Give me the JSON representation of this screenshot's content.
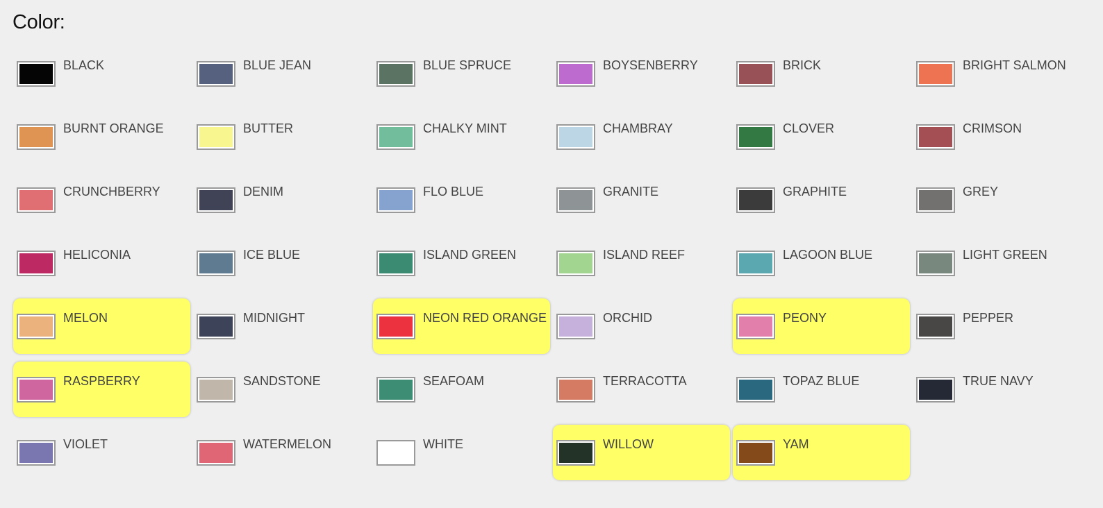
{
  "heading": "Color:",
  "colors": [
    {
      "name": "BLACK",
      "hex": "#050505",
      "selected": false
    },
    {
      "name": "BLUE JEAN",
      "hex": "#566180",
      "selected": false
    },
    {
      "name": "BLUE SPRUCE",
      "hex": "#5a7362",
      "selected": false
    },
    {
      "name": "BOYSENBERRY",
      "hex": "#bd6bce",
      "selected": false
    },
    {
      "name": "BRICK",
      "hex": "#985157",
      "selected": false
    },
    {
      "name": "BRIGHT SALMON",
      "hex": "#ee7352",
      "selected": false
    },
    {
      "name": "BURNT ORANGE",
      "hex": "#df9454",
      "selected": false
    },
    {
      "name": "BUTTER",
      "hex": "#f8f78f",
      "selected": false
    },
    {
      "name": "CHALKY MINT",
      "hex": "#72be9c",
      "selected": false
    },
    {
      "name": "CHAMBRAY",
      "hex": "#bcd6e6",
      "selected": false
    },
    {
      "name": "CLOVER",
      "hex": "#327944",
      "selected": false
    },
    {
      "name": "CRIMSON",
      "hex": "#a44f54",
      "selected": false
    },
    {
      "name": "CRUNCHBERRY",
      "hex": "#df6f73",
      "selected": false
    },
    {
      "name": "DENIM",
      "hex": "#404355",
      "selected": false
    },
    {
      "name": "FLO BLUE",
      "hex": "#86a3cf",
      "selected": false
    },
    {
      "name": "GRANITE",
      "hex": "#8e9496",
      "selected": false
    },
    {
      "name": "GRAPHITE",
      "hex": "#3b3b3b",
      "selected": false
    },
    {
      "name": "GREY",
      "hex": "#727170",
      "selected": false
    },
    {
      "name": "HELICONIA",
      "hex": "#bd2a63",
      "selected": false
    },
    {
      "name": "ICE BLUE",
      "hex": "#5f7b91",
      "selected": false
    },
    {
      "name": "ISLAND GREEN",
      "hex": "#3b8b73",
      "selected": false
    },
    {
      "name": "ISLAND REEF",
      "hex": "#a2d690",
      "selected": false
    },
    {
      "name": "LAGOON BLUE",
      "hex": "#5ba8b0",
      "selected": false
    },
    {
      "name": "LIGHT GREEN",
      "hex": "#78887f",
      "selected": false
    },
    {
      "name": "MELON",
      "hex": "#ecb27d",
      "selected": true
    },
    {
      "name": "MIDNIGHT",
      "hex": "#3d4459",
      "selected": false
    },
    {
      "name": "NEON RED ORANGE",
      "hex": "#ec323f",
      "selected": true
    },
    {
      "name": "ORCHID",
      "hex": "#c5b1dc",
      "selected": false
    },
    {
      "name": "PEONY",
      "hex": "#e27faa",
      "selected": true
    },
    {
      "name": "PEPPER",
      "hex": "#484746",
      "selected": false
    },
    {
      "name": "RASPBERRY",
      "hex": "#d066a0",
      "selected": true
    },
    {
      "name": "SANDSTONE",
      "hex": "#c0b7aa",
      "selected": false
    },
    {
      "name": "SEAFOAM",
      "hex": "#3d8c74",
      "selected": false
    },
    {
      "name": "TERRACOTTA",
      "hex": "#d57b63",
      "selected": false
    },
    {
      "name": "TOPAZ BLUE",
      "hex": "#2a687f",
      "selected": false
    },
    {
      "name": "TRUE NAVY",
      "hex": "#252835",
      "selected": false
    },
    {
      "name": "VIOLET",
      "hex": "#7976b0",
      "selected": false
    },
    {
      "name": "WATERMELON",
      "hex": "#e06575",
      "selected": false
    },
    {
      "name": "WHITE",
      "hex": "#ffffff",
      "selected": false
    },
    {
      "name": "WILLOW",
      "hex": "#243328",
      "selected": true
    },
    {
      "name": "YAM",
      "hex": "#844a19",
      "selected": true
    }
  ]
}
